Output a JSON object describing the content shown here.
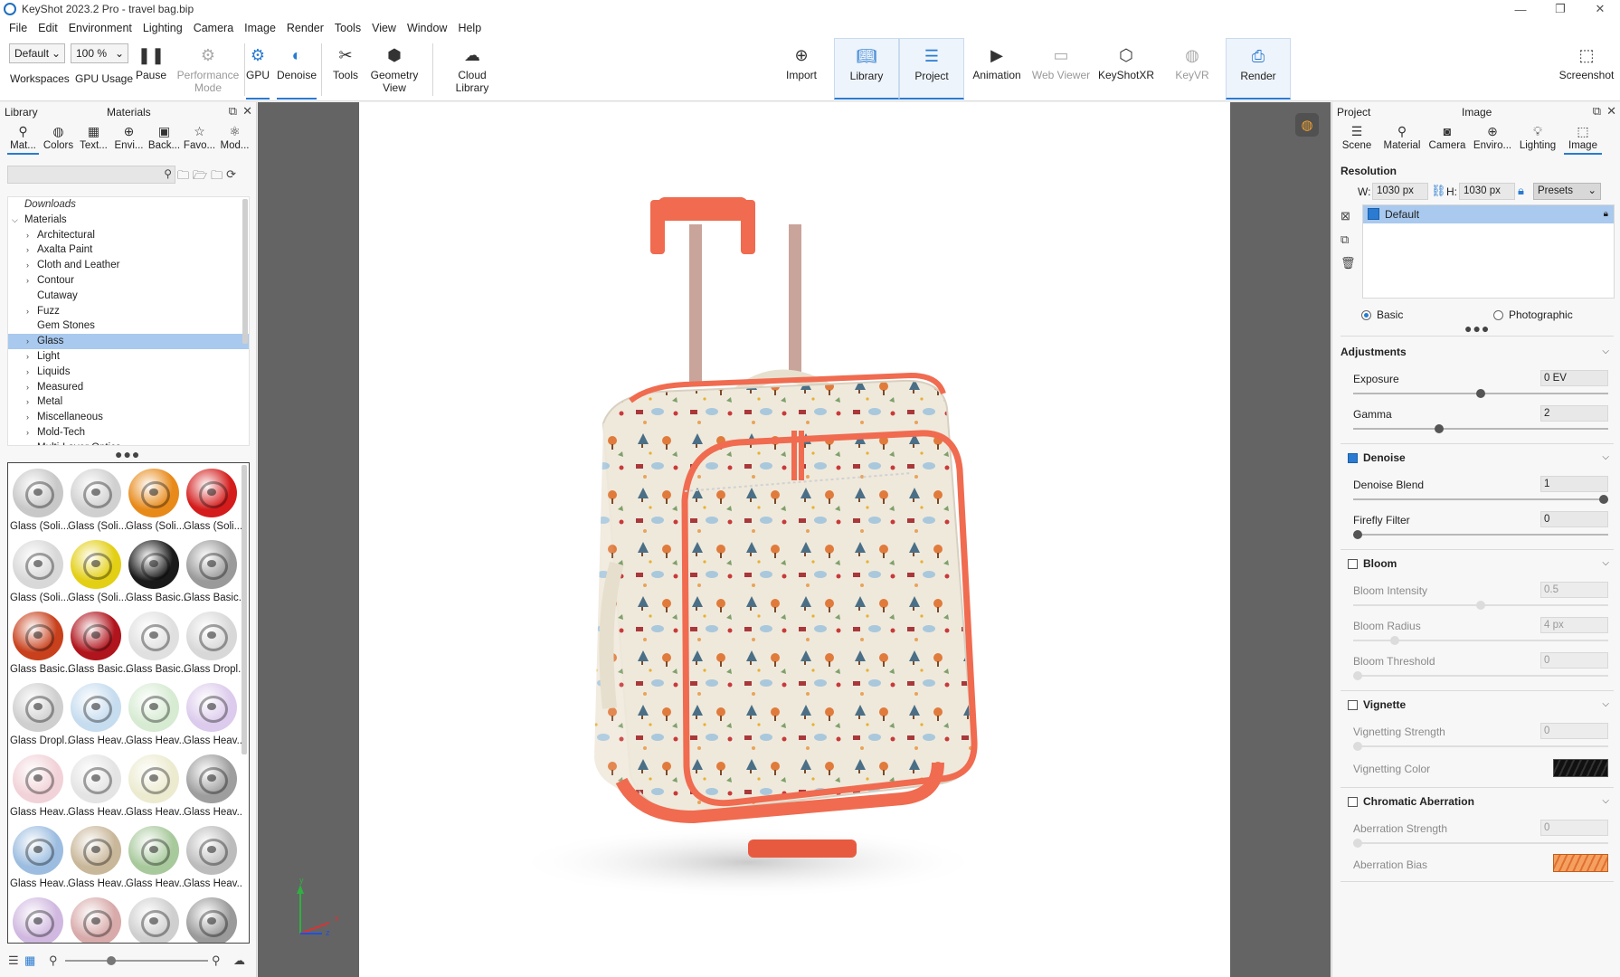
{
  "window": {
    "title": "KeyShot 2023.2 Pro  - travel bag.bip",
    "controls": [
      "—",
      "❐",
      "✕"
    ]
  },
  "menu": [
    "File",
    "Edit",
    "Environment",
    "Lighting",
    "Camera",
    "Image",
    "Render",
    "Tools",
    "View",
    "Window",
    "Help"
  ],
  "toolbar": {
    "workspace_value": "Default",
    "gpu_usage_value": "100 %",
    "workspaces_label": "Workspaces",
    "gpu_usage_label": "GPU Usage",
    "pause_label": "Pause",
    "performance_label_1": "Performance",
    "performance_label_2": "Mode",
    "gpu_label": "GPU",
    "denoise_label": "Denoise",
    "tools_label": "Tools",
    "geometry_label_1": "Geometry",
    "geometry_label_2": "View",
    "cloud_label_1": "Cloud",
    "cloud_label_2": "Library",
    "import_label": "Import",
    "library_label": "Library",
    "project_label": "Project",
    "animation_label": "Animation",
    "webviewer_label": "Web Viewer",
    "keyshotxr_label": "KeyShotXR",
    "keyvr_label": "KeyVR",
    "render_label": "Render",
    "screenshot_label": "Screenshot"
  },
  "library": {
    "header_left": "Library",
    "header_center": "Materials",
    "tabs": [
      "Mat...",
      "Colors",
      "Text...",
      "Envi...",
      "Back...",
      "Favo...",
      "Mod..."
    ],
    "tree_downloads": "Downloads",
    "tree_root": "Materials",
    "tree_items": [
      {
        "label": "Architectural",
        "arrow": true
      },
      {
        "label": "Axalta Paint",
        "arrow": true
      },
      {
        "label": "Cloth and Leather",
        "arrow": true
      },
      {
        "label": "Contour",
        "arrow": true
      },
      {
        "label": "Cutaway",
        "arrow": false
      },
      {
        "label": "Fuzz",
        "arrow": true
      },
      {
        "label": "Gem Stones",
        "arrow": false
      },
      {
        "label": "Glass",
        "arrow": true
      },
      {
        "label": "Light",
        "arrow": true
      },
      {
        "label": "Liquids",
        "arrow": true
      },
      {
        "label": "Measured",
        "arrow": true
      },
      {
        "label": "Metal",
        "arrow": true
      },
      {
        "label": "Miscellaneous",
        "arrow": true
      },
      {
        "label": "Mold-Tech",
        "arrow": true
      },
      {
        "label": "Multi-Layer Optics",
        "arrow": true
      }
    ],
    "selected_item": "Glass",
    "thumbnails": [
      {
        "label": "Glass (Soli...",
        "color": "#c8c8c8"
      },
      {
        "label": "Glass (Soli...",
        "color": "#d0d0d0"
      },
      {
        "label": "Glass (Soli...",
        "color": "#e88a1a"
      },
      {
        "label": "Glass (Soli...",
        "color": "#d41c1c"
      },
      {
        "label": "Glass (Soli...",
        "color": "#d8d8d8"
      },
      {
        "label": "Glass (Soli...",
        "color": "#e3cf14"
      },
      {
        "label": "Glass Basic...",
        "color": "#1a1a1a"
      },
      {
        "label": "Glass Basic...",
        "color": "#9a9a9a"
      },
      {
        "label": "Glass Basic...",
        "color": "#c8401c"
      },
      {
        "label": "Glass Basic...",
        "color": "#b0141c"
      },
      {
        "label": "Glass Basic...",
        "color": "#e0e0e0"
      },
      {
        "label": "Glass Dropl...",
        "color": "#d8d8d8"
      },
      {
        "label": "Glass Dropl...",
        "color": "#cfcfcf"
      },
      {
        "label": "Glass Heav...",
        "color": "#c6dcef"
      },
      {
        "label": "Glass Heav...",
        "color": "#d6ebd2"
      },
      {
        "label": "Glass Heav...",
        "color": "#dccbec"
      },
      {
        "label": "Glass Heav...",
        "color": "#f1d2d8"
      },
      {
        "label": "Glass Heav...",
        "color": "#e4e4e4"
      },
      {
        "label": "Glass Heav...",
        "color": "#ecebd0"
      },
      {
        "label": "Glass Heav...",
        "color": "#9e9e9e"
      },
      {
        "label": "Glass Heav...",
        "color": "#9cbde0"
      },
      {
        "label": "Glass Heav...",
        "color": "#c9b79a"
      },
      {
        "label": "Glass Heav...",
        "color": "#a8c99c"
      },
      {
        "label": "Glass Heav...",
        "color": "#bcbcbc"
      },
      {
        "label": "",
        "color": "#d0b8e0"
      },
      {
        "label": "",
        "color": "#d8aaaa"
      },
      {
        "label": "",
        "color": "#cfcfcf"
      },
      {
        "label": "",
        "color": "#9a9a9a"
      }
    ]
  },
  "project": {
    "header_left": "Project",
    "header_center": "Image",
    "tabs": [
      "Scene",
      "Material",
      "Camera",
      "Enviro...",
      "Lighting",
      "Image"
    ],
    "resolution_title": "Resolution",
    "w_label": "W:",
    "w_value": "1030 px",
    "h_label": "H:",
    "h_value": "1030 px",
    "presets_label": "Presets",
    "preset_default": "Default",
    "basic_label": "Basic",
    "photographic_label": "Photographic",
    "adjustments": {
      "title": "Adjustments",
      "exposure_label": "Exposure",
      "exposure_value": "0 EV",
      "exposure_frac": 0.5,
      "gamma_label": "Gamma",
      "gamma_value": "2",
      "gamma_frac": 0.33
    },
    "denoise": {
      "title": "Denoise",
      "blend_label": "Denoise Blend",
      "blend_value": "1",
      "blend_frac": 1.0,
      "firefly_label": "Firefly Filter",
      "firefly_value": "0",
      "firefly_frac": 0.0
    },
    "bloom": {
      "title": "Bloom",
      "intensity_label": "Bloom Intensity",
      "intensity_value": "0.5",
      "intensity_frac": 0.5,
      "radius_label": "Bloom Radius",
      "radius_value": "4 px",
      "radius_frac": 0.15,
      "threshold_label": "Bloom Threshold",
      "threshold_value": "0",
      "threshold_frac": 0.0
    },
    "vignette": {
      "title": "Vignette",
      "strength_label": "Vignetting Strength",
      "strength_value": "0",
      "strength_frac": 0.0,
      "color_label": "Vignetting Color"
    },
    "chromatic": {
      "title": "Chromatic Aberration",
      "strength_label": "Aberration Strength",
      "strength_value": "0",
      "strength_frac": 0.0,
      "bias_label": "Aberration Bias"
    }
  },
  "axis": {
    "y": "y",
    "x": "x",
    "z": "z"
  }
}
